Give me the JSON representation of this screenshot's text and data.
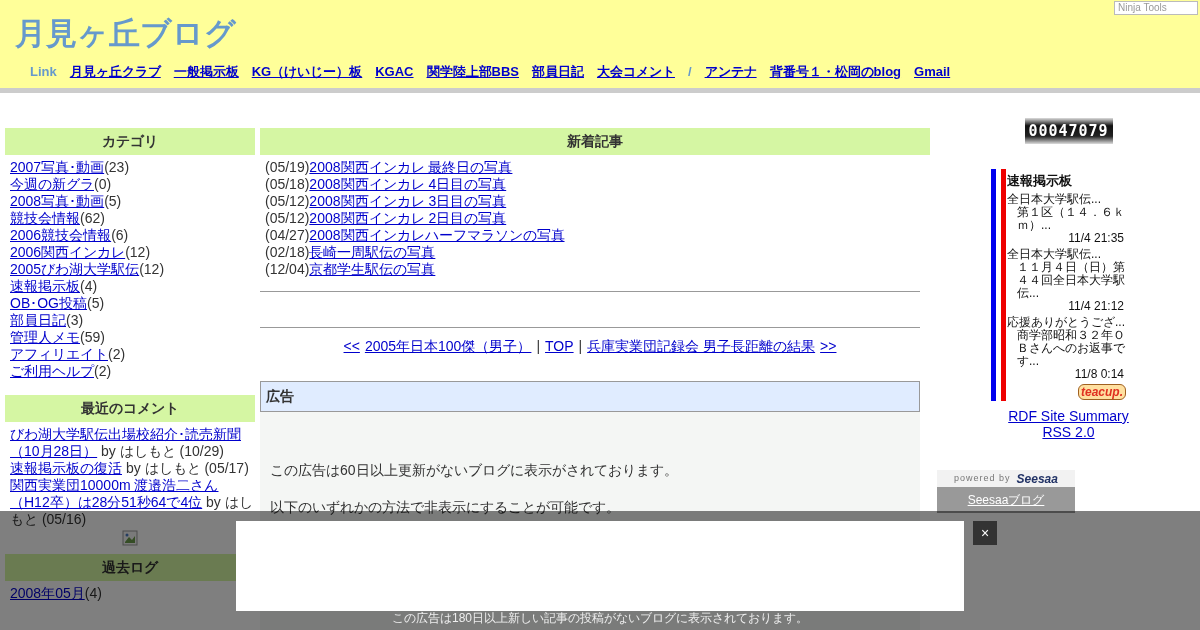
{
  "site_title": "月見ヶ丘ブログ",
  "ninja_tools": "Ninja Tools",
  "nav": {
    "label": "Link",
    "items": [
      {
        "kind": "link",
        "text": "月見ヶ丘クラブ"
      },
      {
        "kind": "link",
        "text": "一般掲示板"
      },
      {
        "kind": "link",
        "text": "KG（けいじー）板"
      },
      {
        "kind": "link",
        "text": "KGAC"
      },
      {
        "kind": "link",
        "text": "関学陸上部BBS"
      },
      {
        "kind": "link",
        "text": "部員日記"
      },
      {
        "kind": "link",
        "text": "大会コメント"
      },
      {
        "kind": "separator",
        "text": "/"
      },
      {
        "kind": "link",
        "text": "アンテナ"
      },
      {
        "kind": "link",
        "text": "背番号１・松岡のblog"
      },
      {
        "kind": "link",
        "text": "Gmail"
      }
    ]
  },
  "categories": {
    "title": "カテゴリ",
    "items": [
      {
        "name": "2007写真･動画",
        "count": "(23)"
      },
      {
        "name": "今週の新グラ",
        "count": "(0)"
      },
      {
        "name": "2008写真･動画",
        "count": "(5)"
      },
      {
        "name": "競技会情報",
        "count": "(62)"
      },
      {
        "name": "2006競技会情報",
        "count": "(6)"
      },
      {
        "name": "2006関西インカレ",
        "count": "(12)"
      },
      {
        "name": "2005びわ湖大学駅伝",
        "count": "(12)"
      },
      {
        "name": "速報掲示板",
        "count": "(4)"
      },
      {
        "name": "OB･OG投稿",
        "count": "(5)"
      },
      {
        "name": "部員日記",
        "count": "(3)"
      },
      {
        "name": "管理人メモ",
        "count": "(59)"
      },
      {
        "name": "アフィリエイト",
        "count": "(2)"
      },
      {
        "name": "ご利用ヘルプ",
        "count": "(2)"
      }
    ]
  },
  "recent_comments": {
    "title": "最近のコメント",
    "items": [
      {
        "article": "びわ湖大学駅伝出場校紹介･読売新聞（10月28日）",
        "meta": "by はしもと (10/29)"
      },
      {
        "article": "速報掲示板の復活",
        "meta": "by はしもと (05/17)"
      },
      {
        "article": "関西実業団10000m 渡邉浩二さん（H12卒）は28分51秒64で4位",
        "meta": "by はしもと (05/16)"
      }
    ]
  },
  "archive": {
    "title": "過去ログ",
    "items": [
      {
        "name": "2008年05月",
        "count": "(4)"
      }
    ]
  },
  "new_articles": {
    "title": "新着記事",
    "items": [
      {
        "date": "(05/19)",
        "title": "2008関西インカレ 最終日の写真"
      },
      {
        "date": "(05/18)",
        "title": "2008関西インカレ 4日目の写真"
      },
      {
        "date": "(05/12)",
        "title": "2008関西インカレ 3日目の写真"
      },
      {
        "date": "(05/12)",
        "title": "2008関西インカレ 2日目の写真"
      },
      {
        "date": "(04/27)",
        "title": "2008関西インカレハーフマラソンの写真"
      },
      {
        "date": "(02/18)",
        "title": "長崎一周駅伝の写真"
      },
      {
        "date": "(12/04)",
        "title": "京都学生駅伝の写真"
      }
    ]
  },
  "pager": [
    {
      "kind": "link",
      "text": "<<"
    },
    {
      "kind": "link",
      "text": "2005年日本100傑（男子）"
    },
    {
      "kind": "separator",
      "text": "|"
    },
    {
      "kind": "link",
      "text": "TOP"
    },
    {
      "kind": "separator",
      "text": "|"
    },
    {
      "kind": "link",
      "text": "兵庫実業団記録会 男子長距離の結果"
    },
    {
      "kind": "link",
      "text": ">>"
    }
  ],
  "ad": {
    "title": "広告",
    "lines": [
      "この広告は60日以上更新がないブログに表示がされております。",
      "以下のいずれかの方法で非表示にすることが可能です。"
    ]
  },
  "counter": "00047079",
  "board": {
    "title": "速報掲示板",
    "posts": [
      {
        "title": "全日本大学駅伝...",
        "body": "第１区（１４．６ｋｍ）...",
        "time": "11/4 21:35"
      },
      {
        "title": "全日本大学駅伝...",
        "body": "１１月４日（日）第４４回全日本大学駅伝...",
        "time": "11/4 21:12"
      },
      {
        "title": "応援ありがとうござ...",
        "body": "商学部昭和３２年ＯＢさんへのお返事です...",
        "time": "11/8 0:14"
      }
    ],
    "logo": "teacup."
  },
  "feeds": [
    "RDF Site Summary",
    "RSS 2.0"
  ],
  "seesaa": {
    "powered": "powered by",
    "brand": "Seesaa",
    "link": "Seesaaブログ"
  },
  "overlay": {
    "close": "×",
    "note": "この広告は180日以上新しい記事の投稿がないブログに表示されております。"
  }
}
